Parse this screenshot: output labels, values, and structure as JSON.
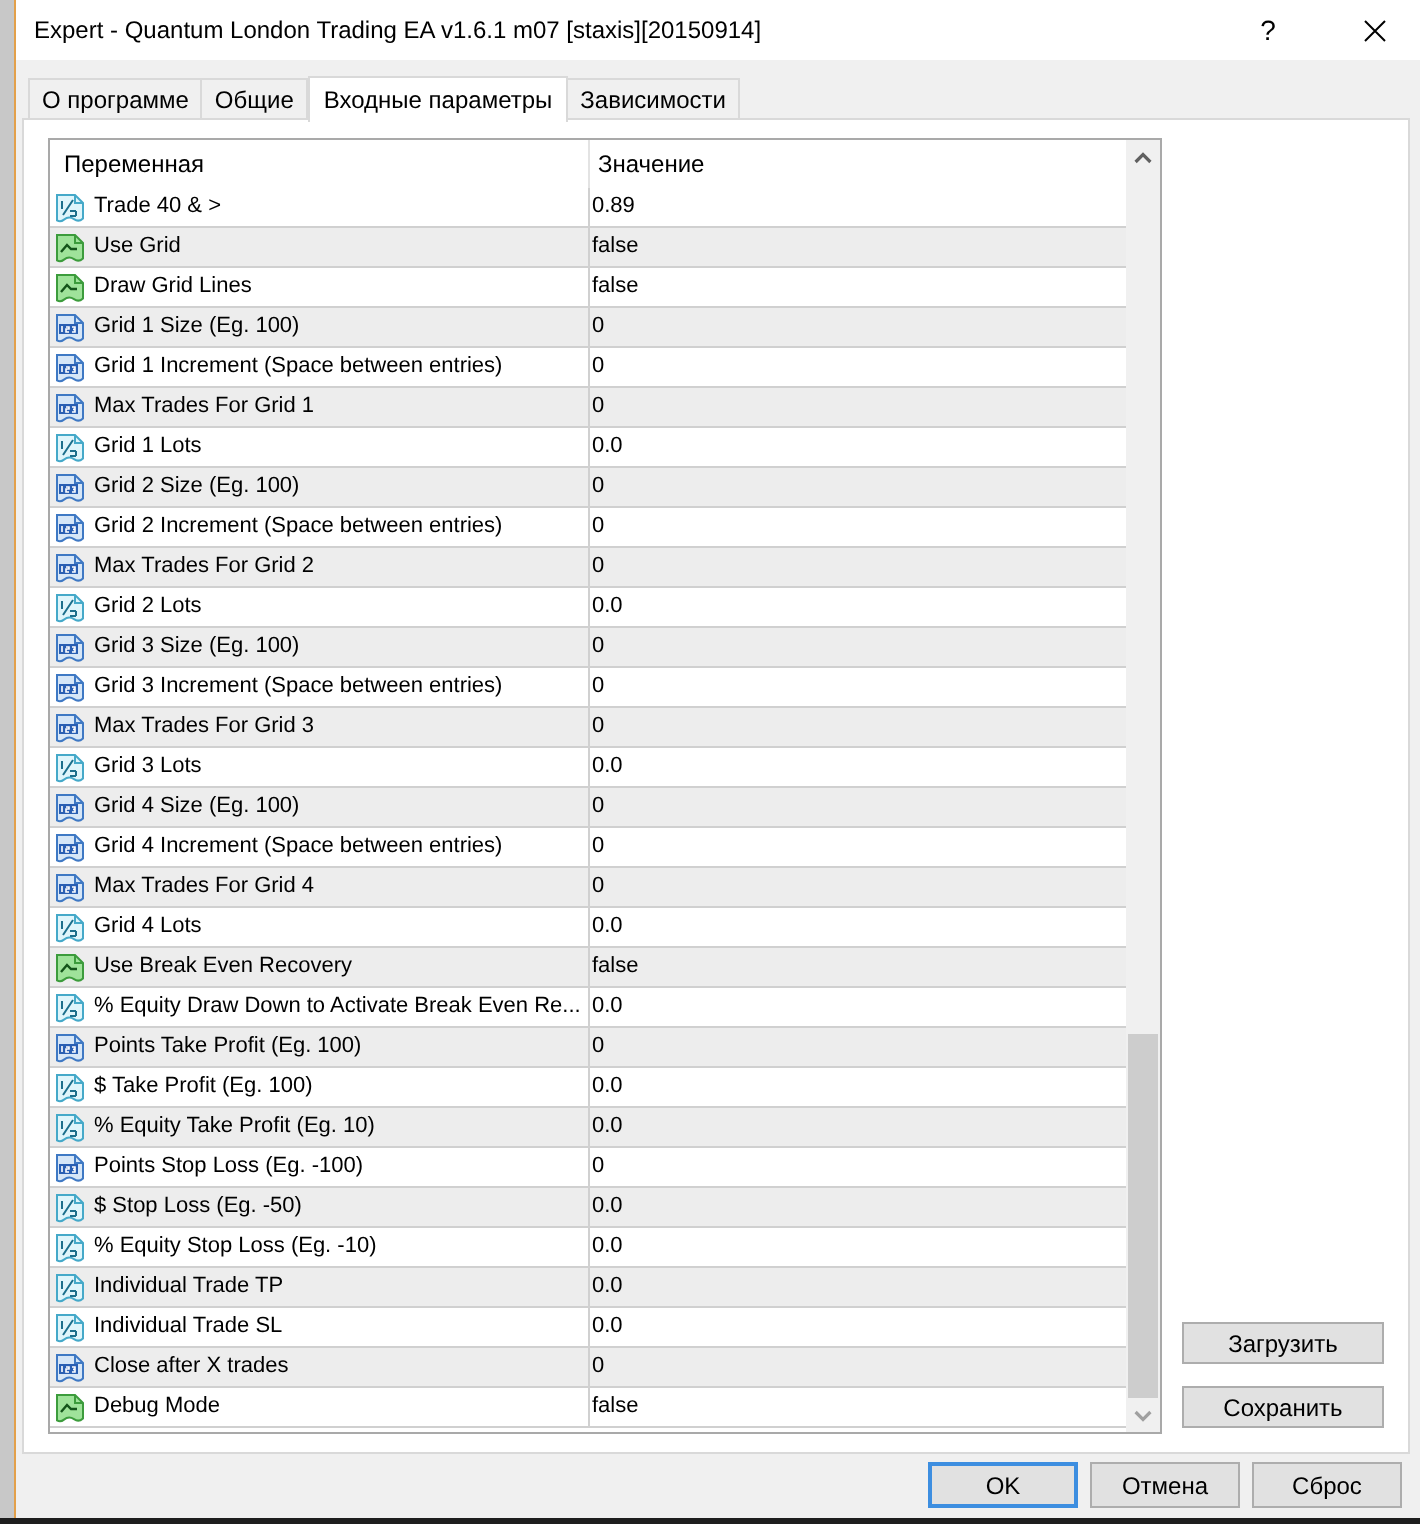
{
  "window": {
    "title": "Expert - Quantum London Trading EA v1.6.1 m07 [staxis][20150914]",
    "help_button": "?"
  },
  "tabs": [
    {
      "label": "О программе",
      "selected": false
    },
    {
      "label": "Общие",
      "selected": false
    },
    {
      "label": "Входные параметры",
      "selected": true
    },
    {
      "label": "Зависимости",
      "selected": false
    }
  ],
  "table": {
    "columns": [
      "Переменная",
      "Значение"
    ],
    "rows": [
      {
        "kind": "double",
        "name": "Trade 40 & >",
        "value": "0.89"
      },
      {
        "kind": "bool",
        "name": "Use Grid",
        "value": "false"
      },
      {
        "kind": "bool",
        "name": "Draw Grid Lines",
        "value": "false"
      },
      {
        "kind": "int",
        "name": "Grid 1 Size (Eg. 100)",
        "value": "0"
      },
      {
        "kind": "int",
        "name": "Grid 1 Increment (Space between entries)",
        "value": "0"
      },
      {
        "kind": "int",
        "name": "Max Trades For Grid 1",
        "value": "0"
      },
      {
        "kind": "double",
        "name": "Grid 1 Lots",
        "value": "0.0"
      },
      {
        "kind": "int",
        "name": "Grid 2 Size (Eg. 100)",
        "value": "0"
      },
      {
        "kind": "int",
        "name": "Grid 2 Increment (Space between entries)",
        "value": "0"
      },
      {
        "kind": "int",
        "name": "Max Trades For Grid 2",
        "value": "0"
      },
      {
        "kind": "double",
        "name": "Grid 2 Lots",
        "value": "0.0"
      },
      {
        "kind": "int",
        "name": "Grid 3 Size (Eg. 100)",
        "value": "0"
      },
      {
        "kind": "int",
        "name": "Grid 3 Increment (Space between entries)",
        "value": "0"
      },
      {
        "kind": "int",
        "name": "Max Trades For Grid 3",
        "value": "0"
      },
      {
        "kind": "double",
        "name": "Grid 3 Lots",
        "value": "0.0"
      },
      {
        "kind": "int",
        "name": "Grid 4 Size (Eg. 100)",
        "value": "0"
      },
      {
        "kind": "int",
        "name": "Grid 4 Increment (Space between entries)",
        "value": "0"
      },
      {
        "kind": "int",
        "name": "Max Trades For Grid 4",
        "value": "0"
      },
      {
        "kind": "double",
        "name": "Grid 4 Lots",
        "value": "0.0"
      },
      {
        "kind": "bool",
        "name": "Use Break Even Recovery",
        "value": "false"
      },
      {
        "kind": "double",
        "name": "% Equity Draw Down to Activate Break Even Re...",
        "value": "0.0"
      },
      {
        "kind": "int",
        "name": "Points Take Profit (Eg. 100)",
        "value": "0"
      },
      {
        "kind": "double",
        "name": "$ Take Profit (Eg. 100)",
        "value": "0.0"
      },
      {
        "kind": "double",
        "name": "% Equity Take Profit (Eg. 10)",
        "value": "0.0"
      },
      {
        "kind": "int",
        "name": "Points Stop Loss (Eg. -100)",
        "value": "0"
      },
      {
        "kind": "double",
        "name": "$ Stop Loss (Eg. -50)",
        "value": "0.0"
      },
      {
        "kind": "double",
        "name": "% Equity Stop Loss (Eg. -10)",
        "value": "0.0"
      },
      {
        "kind": "double",
        "name": "Individual Trade TP",
        "value": "0.0"
      },
      {
        "kind": "double",
        "name": "Individual Trade SL",
        "value": "0.0"
      },
      {
        "kind": "int",
        "name": "Close after X trades",
        "value": "0"
      },
      {
        "kind": "bool",
        "name": "Debug Mode",
        "value": "false"
      }
    ]
  },
  "side_buttons": [
    "Загрузить",
    "Сохранить"
  ],
  "buttons": [
    {
      "label": "OK",
      "default": true
    },
    {
      "label": "Отмена",
      "default": false
    },
    {
      "label": "Сброс",
      "default": false
    }
  ]
}
